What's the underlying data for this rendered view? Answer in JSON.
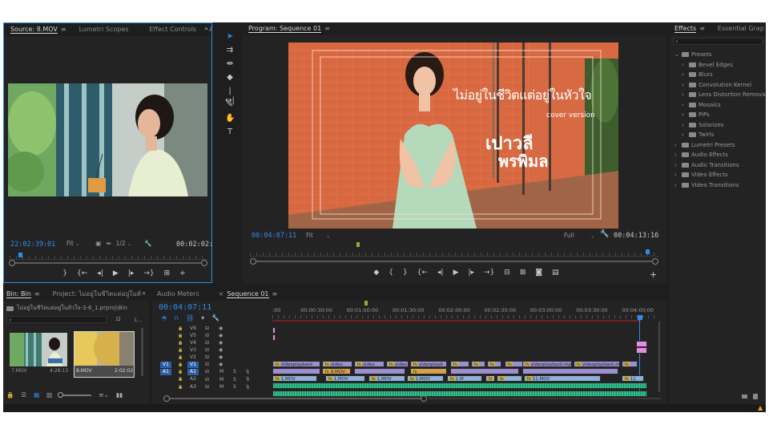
{
  "colors": {
    "accent": "#2d8ceb",
    "panel": "#232323",
    "bg": "#1e1e1e",
    "video_clip": "#9b8fcf",
    "audio_clip": "#2fbd8a",
    "v1_clip": "#8fb1d8",
    "orange_clip": "#d4a24a",
    "pink_clip": "#e48de0"
  },
  "source": {
    "tabs": [
      "Source: 8.MOV",
      "Lumetri Scopes",
      "Effect Controls",
      "Audi"
    ],
    "timecode": "22:02:39:01",
    "fit": "Fit",
    "resolution": "1/2",
    "duration": "00:02:02:"
  },
  "toolbar": {
    "icons": [
      "selection-tool-icon",
      "track-select-icon",
      "ripple-edit-icon",
      "razor-icon",
      "slip-icon",
      "pen-icon",
      "hand-icon",
      "type-icon"
    ]
  },
  "program": {
    "tab": "Program: Sequence 01",
    "timecode": "00:04:07:11",
    "fit": "Fit",
    "resolution": "Full",
    "duration": "00:04:13:16",
    "overlay": {
      "title": "ไม่อยู่ในชีวิตแต่อยู่ในหัวใจ",
      "subtitle": "cover version",
      "name1": "เปาวลี",
      "name2": "พรพิมล"
    }
  },
  "effects": {
    "tabs": [
      "Effects",
      "Essential Grap"
    ],
    "tree": [
      {
        "label": "Presets",
        "level": 0,
        "open": true
      },
      {
        "label": "Bevel Edges",
        "level": 1
      },
      {
        "label": "Blurs",
        "level": 1
      },
      {
        "label": "Convolution Kernel",
        "level": 1
      },
      {
        "label": "Lens Distortion Removal",
        "level": 1
      },
      {
        "label": "Mosaics",
        "level": 1
      },
      {
        "label": "PiPs",
        "level": 1
      },
      {
        "label": "Solarizes",
        "level": 1
      },
      {
        "label": "Twirls",
        "level": 1
      },
      {
        "label": "Lumetri Presets",
        "level": 0
      },
      {
        "label": "Audio Effects",
        "level": 0
      },
      {
        "label": "Audio Transitions",
        "level": 0
      },
      {
        "label": "Video Effects",
        "level": 0
      },
      {
        "label": "Video Transitions",
        "level": 0
      }
    ]
  },
  "project": {
    "tabs": [
      "Bin: Bin",
      "Project: ไม่อยู่ในชีวิตแต่อยู่ในหั"
    ],
    "path": "ไม่อยู่ในชีวิตแต่อยู่ในหัวใจ-3-6_1.prproj\\Bin",
    "items": [
      {
        "name": "7.MOV",
        "duration": "4:28:13"
      },
      {
        "name": "8.MOV",
        "duration": "2:02:02"
      }
    ],
    "count": "1..."
  },
  "audio_meters": {
    "tab": "Audio Meters"
  },
  "timeline": {
    "tab": "Sequence 01",
    "timecode": "00:04:07:11",
    "ruler": [
      ":00",
      "00:00:30:00",
      "00:01:00:00",
      "00:01:30:00",
      "00:02:00:00",
      "00:02:30:00",
      "00:03:00:00",
      "00:03:30:00",
      "00:04:00:00"
    ],
    "video_tracks": [
      "V6",
      "V5",
      "V4",
      "V3",
      "V2",
      "V1"
    ],
    "audio_tracks": [
      "A1",
      "A2",
      "A3"
    ],
    "source_patch_video": "V1",
    "source_patch_audio": "A1",
    "mute": "M",
    "solo": "S",
    "v3_clips": [
      "videoplayback",
      "video",
      "video",
      "video",
      "videoplayb",
      "videoplayback.mp",
      "videoplayback.m"
    ],
    "v2_clips": [
      "9.MOV"
    ],
    "v1_clips": [
      "1.MOV",
      "1.MOV",
      "1.MOV",
      "1.MOV",
      "1.M",
      "11.MOV",
      "11"
    ]
  }
}
